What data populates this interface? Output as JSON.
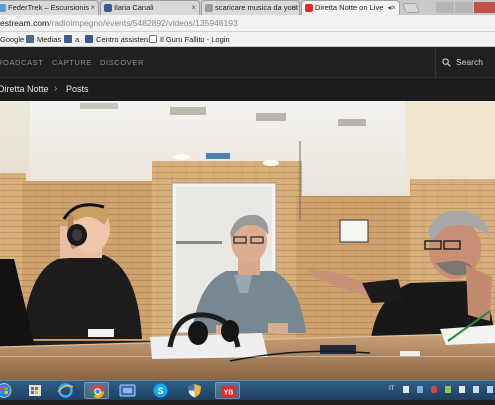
{
  "browser": {
    "tabs": [
      {
        "title": "FederTrek – Escursionis",
        "icon": "chrome-page-icon",
        "active": false
      },
      {
        "title": "Ilaria Canali",
        "icon": "facebook-icon",
        "active": false
      },
      {
        "title": "scaricare musica da yout",
        "icon": "page-icon",
        "active": false
      },
      {
        "title": "Diretta Notte on Live",
        "icon": "youtube-icon",
        "active": true
      }
    ],
    "url_prefix": "estream.com",
    "url_path": "/radioimpegno/events/5482892/videos/135946193",
    "bookmarks": [
      {
        "label": "Google",
        "icon": "google-icon"
      },
      {
        "label": "Medias",
        "icon": "medias-icon"
      },
      {
        "label": "a",
        "icon": "facebook-icon"
      },
      {
        "label": "Centro assistenza",
        "icon": "facebook-icon"
      },
      {
        "label": "Il Guru Fallito - Login",
        "icon": "page-icon"
      }
    ]
  },
  "site": {
    "nav": [
      "ROADCAST",
      "CAPTURE",
      "DISCOVER"
    ],
    "search_label": "Search",
    "breadcrumb": [
      "Diretta Notte",
      "Posts"
    ]
  },
  "taskbar": {
    "apps": [
      "start-orb",
      "app-grid",
      "internet-explorer",
      "chrome",
      "media-player",
      "skype",
      "shield-app",
      "yb-app"
    ],
    "tray_language": "IT"
  },
  "colors": {
    "facebook": "#3b5998",
    "youtube": "#e52d27",
    "site_nav_bg": "#202020",
    "taskbar": "#2f5e86"
  }
}
